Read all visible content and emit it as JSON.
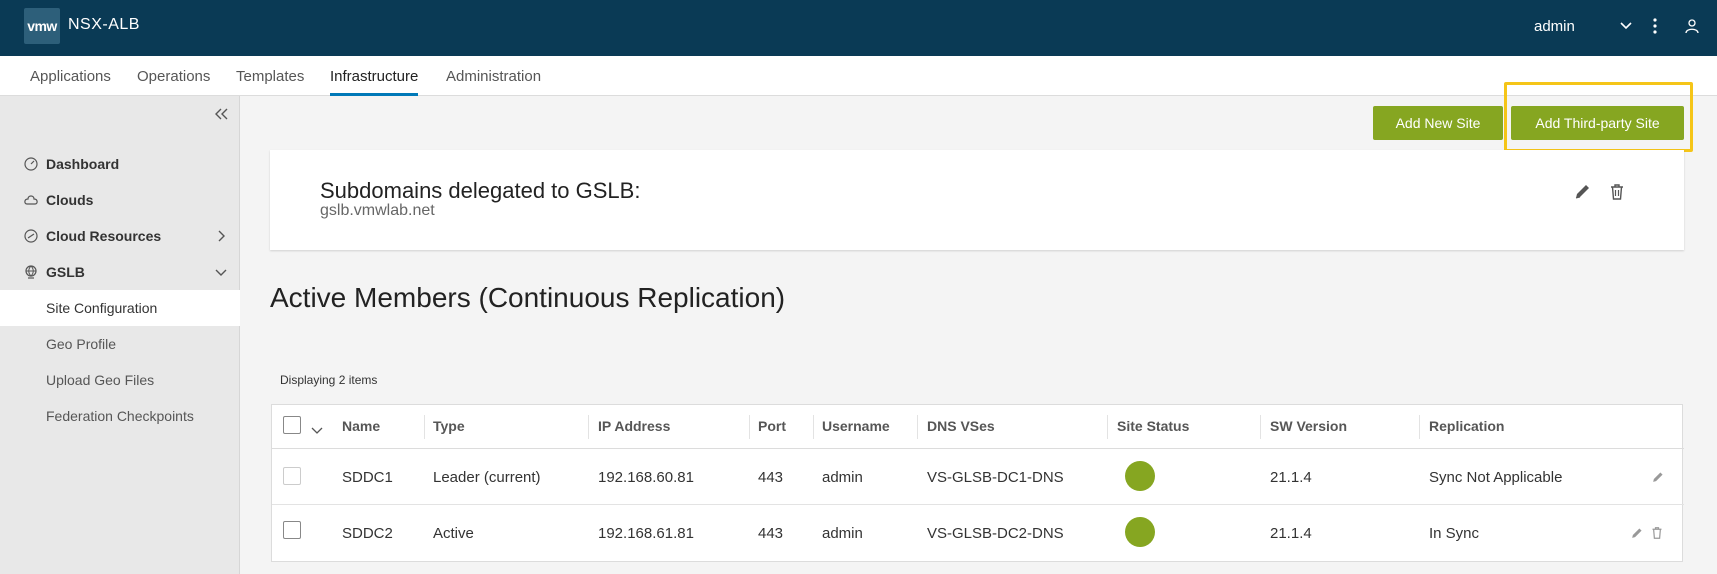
{
  "header": {
    "logo_text": "vmw",
    "app_name": "NSX-ALB",
    "user": "admin"
  },
  "topnav": {
    "tabs": [
      "Applications",
      "Operations",
      "Templates",
      "Infrastructure",
      "Administration"
    ],
    "active": "Infrastructure"
  },
  "sidebar": {
    "items": [
      {
        "label": "Dashboard",
        "icon": "dashboard-icon"
      },
      {
        "label": "Clouds",
        "icon": "cloud-icon"
      },
      {
        "label": "Cloud Resources",
        "icon": "cloud-resources-icon"
      },
      {
        "label": "GSLB",
        "icon": "globe-icon"
      }
    ],
    "subitems": [
      "Site Configuration",
      "Geo Profile",
      "Upload Geo Files",
      "Federation Checkpoints"
    ],
    "active_subitem": "Site Configuration"
  },
  "actions": {
    "add_new_site": "Add New Site",
    "add_third_party_site": "Add Third-party Site"
  },
  "subdomains": {
    "title": "Subdomains delegated to GSLB:",
    "value": "gslb.vmwlab.net"
  },
  "members": {
    "title": "Active Members (Continuous Replication)",
    "count_text": "Displaying 2 items",
    "columns": [
      "Name",
      "Type",
      "IP Address",
      "Port",
      "Username",
      "DNS VSes",
      "Site Status",
      "SW Version",
      "Replication"
    ],
    "rows": [
      {
        "name": "SDDC1",
        "type": "Leader (current)",
        "ip": "192.168.60.81",
        "port": "443",
        "username": "admin",
        "dns_vses": "VS-GLSB-DC1-DNS",
        "status_color": "#86a621",
        "sw_version": "21.1.4",
        "replication": "Sync Not Applicable"
      },
      {
        "name": "SDDC2",
        "type": "Active",
        "ip": "192.168.61.81",
        "port": "443",
        "username": "admin",
        "dns_vses": "VS-GLSB-DC2-DNS",
        "status_color": "#86a621",
        "sw_version": "21.1.4",
        "replication": "In Sync"
      }
    ]
  },
  "colors": {
    "header_bg": "#0a3a55",
    "accent_green": "#86a621",
    "highlight": "#f5c518",
    "tab_underline": "#0079b8"
  }
}
